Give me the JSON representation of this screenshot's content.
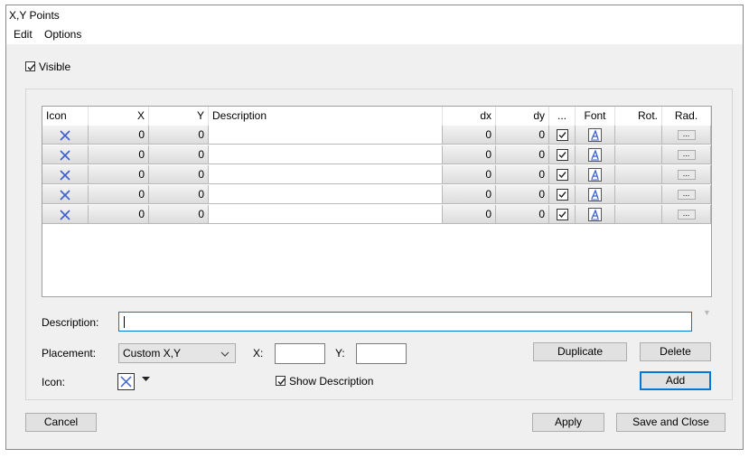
{
  "window": {
    "title": "X,Y Points"
  },
  "menu": {
    "edit": "Edit",
    "options": "Options"
  },
  "visible": {
    "label": "Visible",
    "checked": true
  },
  "grid": {
    "columns": [
      "Icon",
      "X",
      "Y",
      "Description",
      "dx",
      "dy",
      "...",
      "Font",
      "Rot.",
      "Rad."
    ],
    "rows": [
      {
        "x": "0",
        "y": "0",
        "description": "",
        "dx": "0",
        "dy": "0",
        "checked": true,
        "rot": "",
        "rad_button": "..."
      },
      {
        "x": "0",
        "y": "0",
        "description": "",
        "dx": "0",
        "dy": "0",
        "checked": true,
        "rot": "",
        "rad_button": "..."
      },
      {
        "x": "0",
        "y": "0",
        "description": "",
        "dx": "0",
        "dy": "0",
        "checked": true,
        "rot": "",
        "rad_button": "..."
      },
      {
        "x": "0",
        "y": "0",
        "description": "",
        "dx": "0",
        "dy": "0",
        "checked": true,
        "rot": "",
        "rad_button": "..."
      },
      {
        "x": "0",
        "y": "0",
        "description": "",
        "dx": "0",
        "dy": "0",
        "checked": true,
        "rot": "",
        "rad_button": "..."
      }
    ]
  },
  "form": {
    "description_label": "Description:",
    "description_value": "",
    "placement_label": "Placement:",
    "placement_value": "Custom X,Y",
    "x_label": "X:",
    "x_value": "",
    "y_label": "Y:",
    "y_value": "",
    "icon_label": "Icon:",
    "show_description_label": "Show Description",
    "show_description_checked": true
  },
  "buttons": {
    "duplicate": "Duplicate",
    "delete": "Delete",
    "add": "Add",
    "cancel": "Cancel",
    "apply": "Apply",
    "save_close": "Save and Close"
  },
  "icons": {
    "point_marker": "x-marker-icon",
    "font": "font-a-icon",
    "dropdown": "chevron-down-icon"
  },
  "colors": {
    "marker": "#3c5fcf",
    "focus": "#0078d7",
    "window_bg": "#f0f0f0"
  }
}
